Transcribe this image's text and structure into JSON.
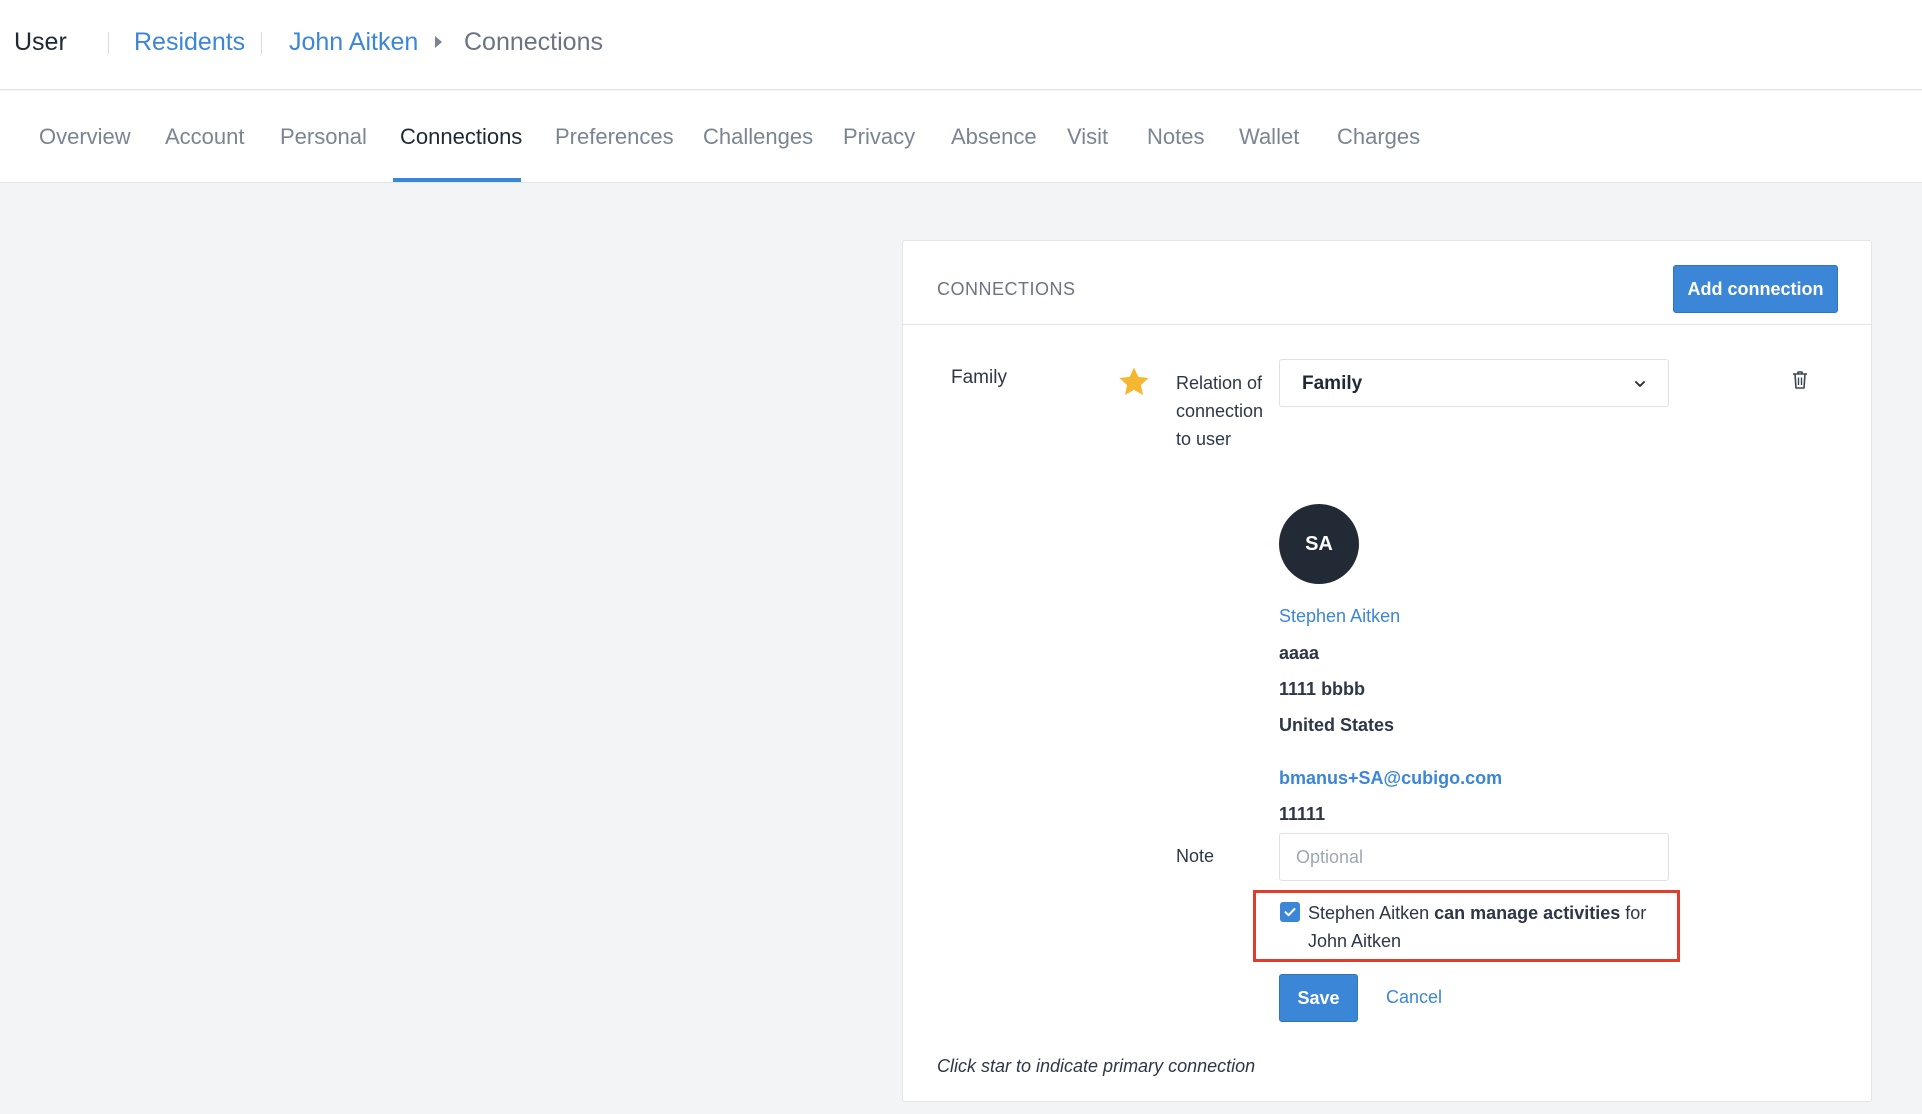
{
  "breadcrumb": {
    "root": "User",
    "residents": "Residents",
    "person": "John Aitken",
    "current": "Connections"
  },
  "tabs": [
    {
      "label": "Overview"
    },
    {
      "label": "Account"
    },
    {
      "label": "Personal"
    },
    {
      "label": "Connections",
      "active": true
    },
    {
      "label": "Preferences"
    },
    {
      "label": "Challenges"
    },
    {
      "label": "Privacy"
    },
    {
      "label": "Absence"
    },
    {
      "label": "Visit"
    },
    {
      "label": "Notes"
    },
    {
      "label": "Wallet"
    },
    {
      "label": "Charges"
    }
  ],
  "card": {
    "title": "CONNECTIONS",
    "add_button": "Add connection"
  },
  "connection": {
    "type": "Family",
    "relation_label": "Relation of connection to user",
    "relation_value": "Family",
    "initials": "SA",
    "name": "Stephen Aitken",
    "address_line1": "aaaa",
    "address_line2": "1111 bbbb",
    "country": "United States",
    "email": "bmanus+SA@cubigo.com",
    "phone": "11111",
    "note_label": "Note",
    "note_placeholder": "Optional",
    "note_value": "",
    "permission": {
      "checked": true,
      "subject": "Stephen Aitken",
      "action": "can manage activities",
      "preposition": "for",
      "target": "John Aitken"
    },
    "save_label": "Save",
    "cancel_label": "Cancel"
  },
  "footnote": "Click star to indicate primary connection",
  "icons": {
    "star": "star-icon",
    "trash": "trash-icon",
    "chevron": "chevron-down-icon",
    "breadcrumb_arrow": "caret-right-icon",
    "check": "check-icon"
  },
  "colors": {
    "accent": "#3b86d6",
    "star": "#f5b731",
    "highlight": "#e23c2c",
    "avatar_bg": "#222a35"
  }
}
